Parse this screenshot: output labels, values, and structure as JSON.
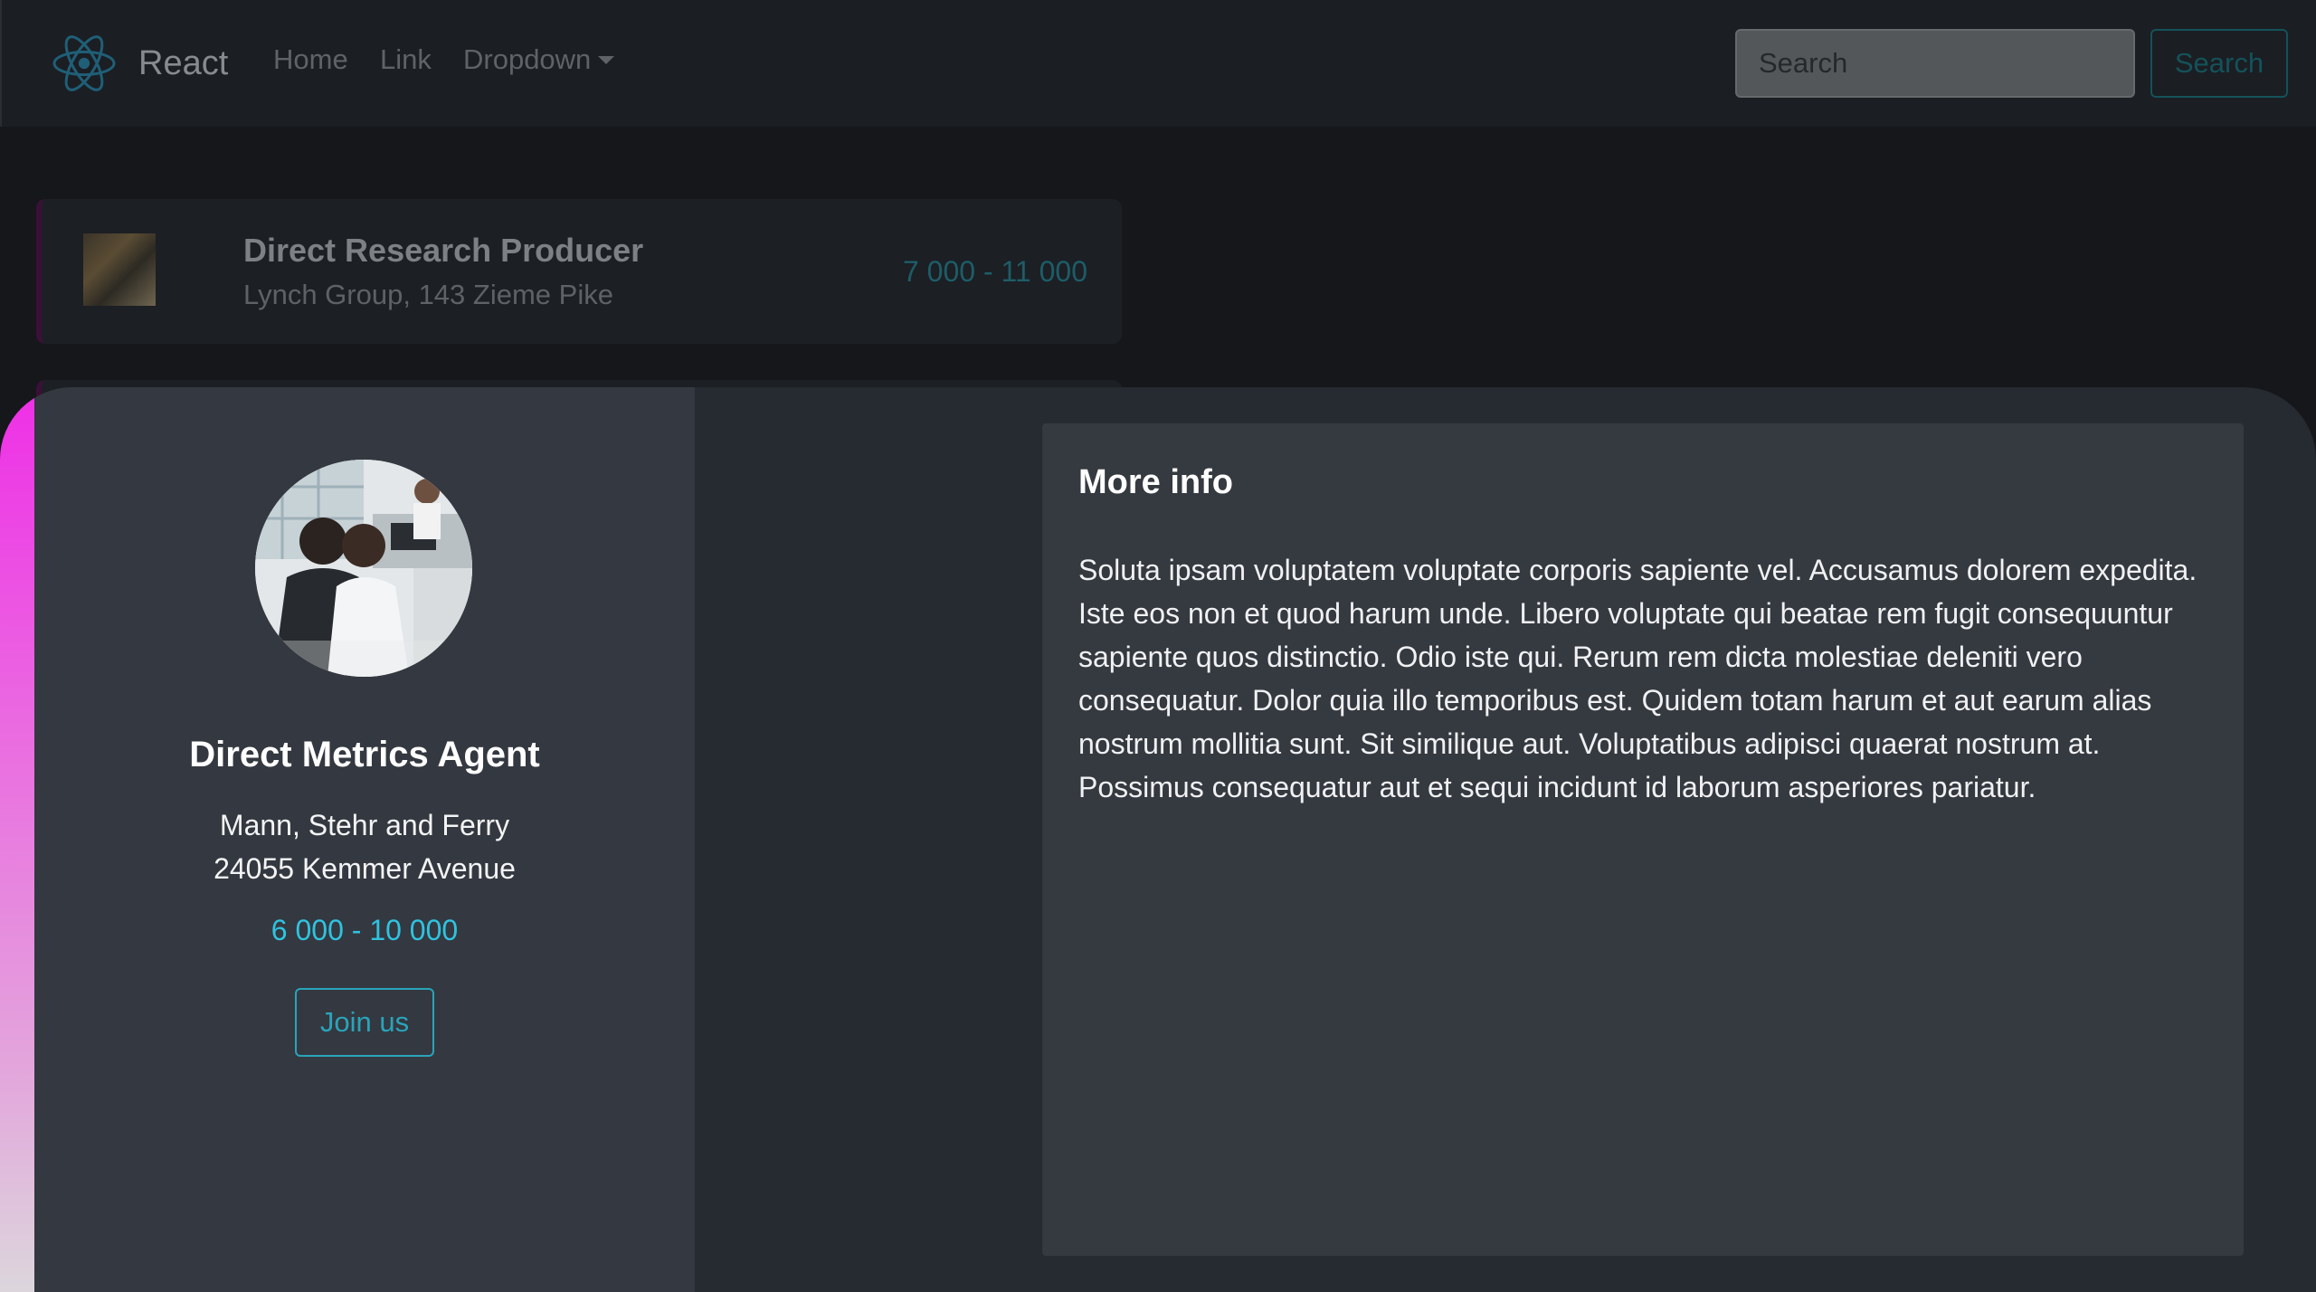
{
  "navbar": {
    "brand": "React",
    "links": {
      "home": "Home",
      "link": "Link",
      "dropdown": "Dropdown"
    },
    "search": {
      "placeholder": "Search",
      "button_label": "Search"
    }
  },
  "job_list": [
    {
      "title": "Direct Research Producer",
      "company_address": "Lynch Group, 143 Zieme Pike",
      "salary": "7 000 - 11 000"
    }
  ],
  "detail": {
    "title": "Direct Metrics Agent",
    "company": "Mann, Stehr and Ferry",
    "address": "24055 Kemmer Avenue",
    "salary": "6 000 - 10 000",
    "join_label": "Join us",
    "more_info": {
      "heading": "More info",
      "body": "Soluta ipsam voluptatem voluptate corporis sapiente vel. Accusamus dolorem expedita. Iste eos non et quod harum unde. Libero voluptate qui beatae rem fugit consequuntur sapiente quos distinctio. Odio iste qui. Rerum rem dicta molestiae deleniti vero consequatur. Dolor quia illo temporibus est. Quidem totam harum et aut earum alias nostrum mollitia sunt. Sit similique aut. Voluptatibus adipisci quaerat nostrum at. Possimus consequatur aut et sequi incidunt id laborum asperiores pariatur."
    }
  },
  "colors": {
    "accent_cyan": "#2fc3e0",
    "accent_magenta": "#ee2fe6",
    "navbar_bg": "#1b1e23",
    "panel_bg": "#262a31"
  },
  "icons": {
    "brand_logo": "react-atom-icon",
    "dropdown_caret": "caret-down-icon"
  }
}
